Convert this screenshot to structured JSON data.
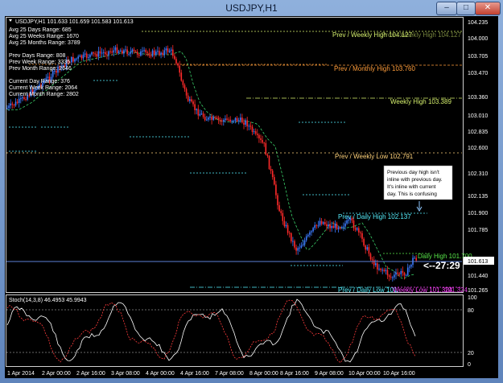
{
  "window": {
    "title": "USDJPY,H1",
    "buttons": {
      "minimize": "–",
      "maximize": "□",
      "close": "✕"
    }
  },
  "info_panel": {
    "header": "USDJPY,H1  101.633 101.659 101.583 101.613",
    "lines": [
      "Avg 25  Days Range: 685",
      "Avg 25  Weeks Range: 1670",
      "Avg 25  Months Range: 3789",
      "",
      "Prev  Days Range: 808",
      "Prev  Week Range: 3335",
      "Prev  Month Range: 2646",
      "",
      "Current  Day Range: 376",
      "Current  Week Range: 2064",
      "Current  Month Range: 2802"
    ]
  },
  "level_labels": {
    "prev_weekly_high": "Prev / Weekly High 104.127",
    "prev_weekly_high_ghost": "Prev / Weekly High 104.127",
    "prev_monthly_high": "Prev / Monthly High 103.760",
    "weekly_high": "Weekly High 103.389",
    "prev_weekly_low": "Prev / Weekly Low 102.791",
    "prev_daily_high": "Prev / Daily High 102.137",
    "daily_high": "Daily High 101.700",
    "prev_daily_low": "Prev / Daily Low 101.",
    "overlap_label": "Weekly Low 101.324",
    "overlap_value": "101.324"
  },
  "annotation": {
    "lines": [
      "Previous day high isn't",
      "inline with previous day.",
      "It's inline with current",
      "day.  This is confusing"
    ]
  },
  "countdown": "<--27:29",
  "price_axis": {
    "ticks": [
      "104.235",
      "104.000",
      "103.705",
      "103.470",
      "103.360",
      "103.010",
      "102.835",
      "102.600",
      "102.310",
      "102.135",
      "101.900",
      "101.785",
      "101.613",
      "101.440",
      "101.265"
    ],
    "current_price": "101.613"
  },
  "stoch": {
    "label": "Stoch(14,3,8) 46.4953 45.9943",
    "levels": [
      "100",
      "80",
      "20",
      "0"
    ],
    "main_color": "#ffffff",
    "signal_color": "#ff3b3b"
  },
  "time_axis": [
    "1 Apr 2014",
    "2 Apr 00:00",
    "2 Apr 16:00",
    "3 Apr 08:00",
    "4 Apr 00:00",
    "4 Apr 16:00",
    "7 Apr 08:00",
    "8 Apr 00:00",
    "8 Apr 16:00",
    "9 Apr 08:00",
    "10 Apr 00:00",
    "10 Apr 16:00"
  ],
  "colors": {
    "background": "#000000",
    "bull_candle": "#3b7bff",
    "bear_candle": "#ff2a2a",
    "weekly_high": "#d7f26e",
    "monthly_high": "#ff9d3a",
    "weekly_low": "#ffd27a",
    "daily_high": "#56f0ff",
    "daily_high_current": "#59e84a",
    "weekly_low_current": "#ff44ff",
    "moving_average": "#3bd16a",
    "stoch_main": "#ffffff",
    "stoch_signal": "#ff3b3b"
  }
}
